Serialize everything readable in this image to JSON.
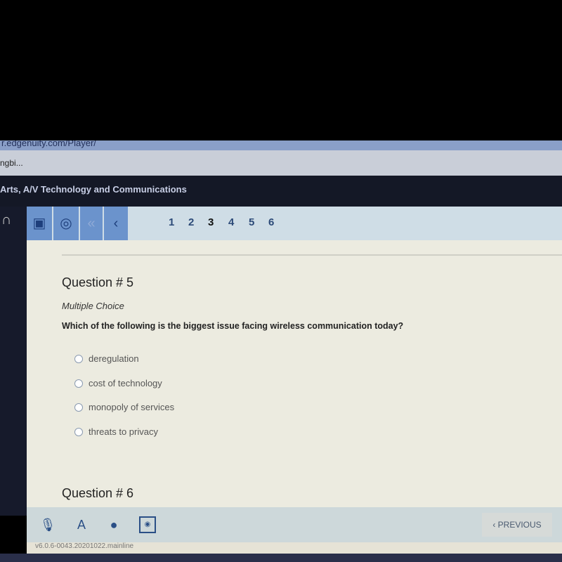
{
  "browser": {
    "url": "r.edgenuity.com/Player/",
    "bookmark": "ngbi..."
  },
  "header": {
    "course_title": "Arts, A/V Technology and Communications"
  },
  "nav": {
    "pages": [
      "1",
      "2",
      "3",
      "4",
      "5",
      "6"
    ],
    "current_page": "3",
    "icons": [
      "book-icon",
      "target-icon",
      "double-chevron-left-icon",
      "chevron-left-icon"
    ]
  },
  "question": {
    "title": "Question # 5",
    "type": "Multiple Choice",
    "text": "Which of the following is the biggest issue facing wireless communication today?",
    "options": [
      "deregulation",
      "cost of technology",
      "monopoly of services",
      "threats to privacy"
    ]
  },
  "next_question": {
    "title": "Question # 6"
  },
  "footer": {
    "previous_label": "‹ PREVIOUS",
    "version": "v6.0.6-0043.20201022.mainline",
    "icons": [
      "microphone-icon",
      "translate-icon",
      "globe-icon",
      "reader-icon"
    ]
  },
  "colors": {
    "accent": "#6b93cc",
    "header_bg": "#141826"
  }
}
